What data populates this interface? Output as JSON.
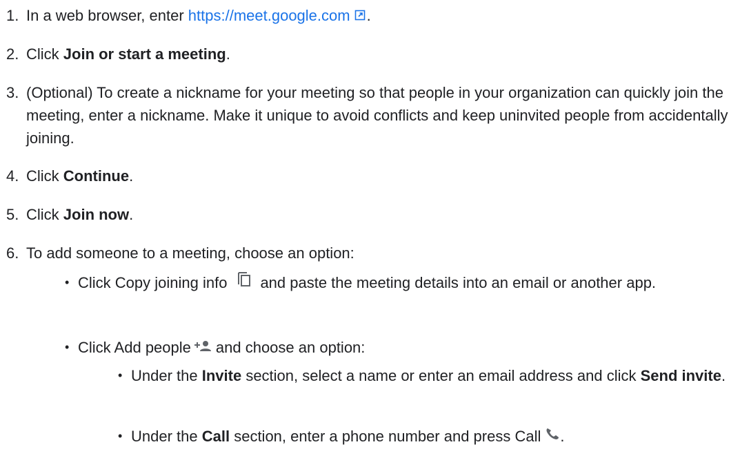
{
  "steps": {
    "s1": {
      "num": "1.",
      "text_before": "In a web browser, enter ",
      "link": "https://meet.google.com",
      "text_after": "."
    },
    "s2": {
      "num": "2.",
      "text_before": "Click ",
      "bold": "Join or start a meeting",
      "text_after": "."
    },
    "s3": {
      "num": "3.",
      "text": "(Optional) To create a nickname for your meeting so that people in your organization can quickly join the meeting, enter a nickname. Make it unique to avoid conflicts and keep uninvited people from accidentally joining."
    },
    "s4": {
      "num": "4.",
      "text_before": "Click ",
      "bold": "Continue",
      "text_after": "."
    },
    "s5": {
      "num": "5.",
      "text_before": "Click ",
      "bold": "Join now",
      "text_after": "."
    },
    "s6": {
      "num": "6.",
      "text": "To add someone to a meeting, choose an option:"
    }
  },
  "options": {
    "bullet": "•",
    "copy": {
      "text_before": "Click Copy joining info",
      "text_after": "and paste the meeting details into an email or another app."
    },
    "add": {
      "text_before": "Click Add people",
      "text_after": "and choose an option:"
    },
    "invite": {
      "text_before": "Under the ",
      "bold1": "Invite",
      "text_mid": " section, select a name or enter an email address and click ",
      "bold2": "Send invite",
      "text_after": "."
    },
    "call": {
      "text_before": "Under the ",
      "bold1": "Call",
      "text_mid": " section, enter a phone number and press Call",
      "text_after": "."
    }
  },
  "icons": {
    "external_link": "external-link-icon",
    "copy": "copy-icon",
    "add_people": "add-people-icon",
    "call": "phone-icon"
  },
  "colors": {
    "text": "#202124",
    "link": "#1a73e8",
    "icon": "#5f6368"
  }
}
